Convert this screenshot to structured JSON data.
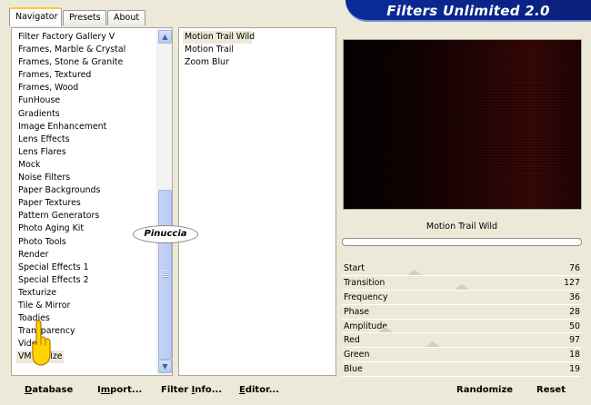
{
  "tabs": [
    {
      "label": "Navigator",
      "active": true
    },
    {
      "label": "Presets",
      "active": false
    },
    {
      "label": "About",
      "active": false
    }
  ],
  "title": "Filters Unlimited 2.0",
  "categories": [
    "Filter Factory Gallery V",
    "Frames, Marble & Crystal",
    "Frames, Stone & Granite",
    "Frames, Textured",
    "Frames, Wood",
    "FunHouse",
    "Gradients",
    "Image Enhancement",
    "Lens Effects",
    "Lens Flares",
    "Mock",
    "Noise Filters",
    "Paper Backgrounds",
    "Paper Textures",
    "Pattern Generators",
    "Photo Aging Kit",
    "Photo Tools",
    "Render",
    "Special Effects 1",
    "Special Effects 2",
    "Texturize",
    "Tile & Mirror",
    "Toadies",
    "Transparency",
    "Video",
    "VM Stylize"
  ],
  "selected_category": "VM Stylize",
  "filters": [
    "Motion Trail Wild",
    "Motion Trail",
    "Zoom Blur"
  ],
  "selected_filter": "Motion Trail Wild",
  "filter_name": "Motion Trail Wild",
  "watermark": "Pinuccia",
  "params": [
    {
      "label": "Start",
      "value": "76"
    },
    {
      "label": "Transition",
      "value": "127"
    },
    {
      "label": "Frequency",
      "value": "36"
    },
    {
      "label": "Phase",
      "value": "28"
    },
    {
      "label": "Amplitude",
      "value": "50"
    },
    {
      "label": "Red",
      "value": "97"
    },
    {
      "label": "Green",
      "value": "18"
    },
    {
      "label": "Blue",
      "value": "19"
    }
  ],
  "buttons": {
    "database": {
      "u": "D",
      "rest": "atabase"
    },
    "import": {
      "pre": "I",
      "u": "m",
      "rest": "port..."
    },
    "filter_info": {
      "pre": "Filter ",
      "u": "I",
      "rest": "nfo..."
    },
    "editor": {
      "u": "E",
      "rest": "ditor..."
    },
    "randomize": "Randomize",
    "reset": "Reset"
  },
  "colors": {
    "title_bg": "#0a2c9a",
    "panel_bg": "#ece9d8"
  }
}
